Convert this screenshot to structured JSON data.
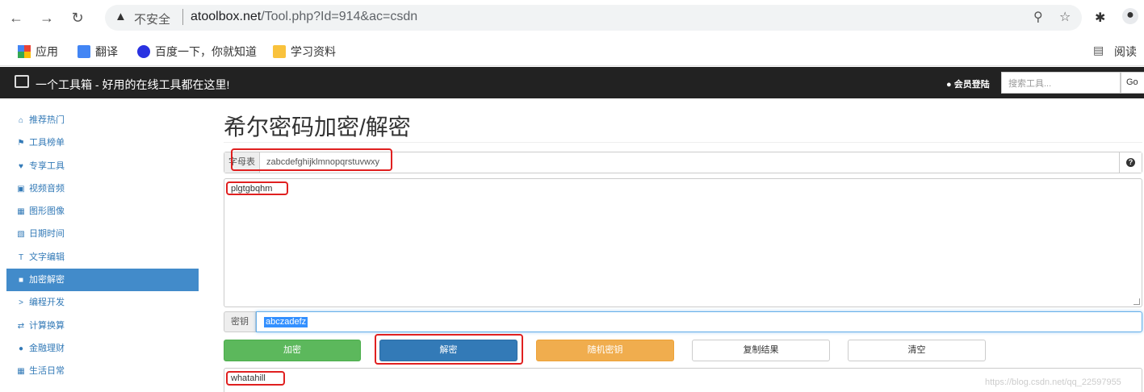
{
  "browser": {
    "insecure_label": "不安全",
    "url_host": "atoolbox.net",
    "url_path": "/Tool.php?Id=914&ac=csdn",
    "bookmarks": [
      "应用",
      "翻译",
      "百度一下，你就知道",
      "学习资料"
    ],
    "reading_label": "阅读"
  },
  "navbar": {
    "brand": "一个工具箱 - 好用的在线工具都在这里!",
    "login": "会员登陆",
    "search_placeholder": "搜索工具...",
    "go": "Go"
  },
  "sidebar": {
    "items": [
      {
        "label": "推荐热门",
        "icon": "home-icon"
      },
      {
        "label": "工具榜单",
        "icon": "flag-icon"
      },
      {
        "label": "专享工具",
        "icon": "heart-icon"
      },
      {
        "label": "视频音频",
        "icon": "film-icon"
      },
      {
        "label": "图形图像",
        "icon": "picture-icon"
      },
      {
        "label": "日期时间",
        "icon": "calendar-icon"
      },
      {
        "label": "文字编辑",
        "icon": "text-icon"
      },
      {
        "label": "加密解密",
        "icon": "lock-icon",
        "active": true
      },
      {
        "label": "编程开发",
        "icon": "terminal-icon"
      },
      {
        "label": "计算换算",
        "icon": "transfer-icon"
      },
      {
        "label": "金融理财",
        "icon": "piggy-bank-icon"
      },
      {
        "label": "生活日常",
        "icon": "grid-icon"
      }
    ]
  },
  "main": {
    "title": "希尔密码加密/解密",
    "alphabet_label": "字母表",
    "alphabet_value": "zabcdefghijklmnopqrstuvwxy",
    "input_text": "plgtgbqhm",
    "key_label": "密钥",
    "key_value": "abczadefz",
    "buttons": {
      "encrypt": "加密",
      "decrypt": "解密",
      "random_key": "随机密钥",
      "copy_result": "复制结果",
      "clear": "清空"
    },
    "result_text": "whatahill",
    "watermark": "https://blog.csdn.net/qq_22597955"
  },
  "colors": {
    "navbar_bg": "#222222",
    "sidebar_active": "#428bca",
    "encrypt_btn": "#5cb85c",
    "decrypt_btn": "#337ab7",
    "random_btn": "#f0ad4e",
    "annotation_red": "#e02020"
  }
}
